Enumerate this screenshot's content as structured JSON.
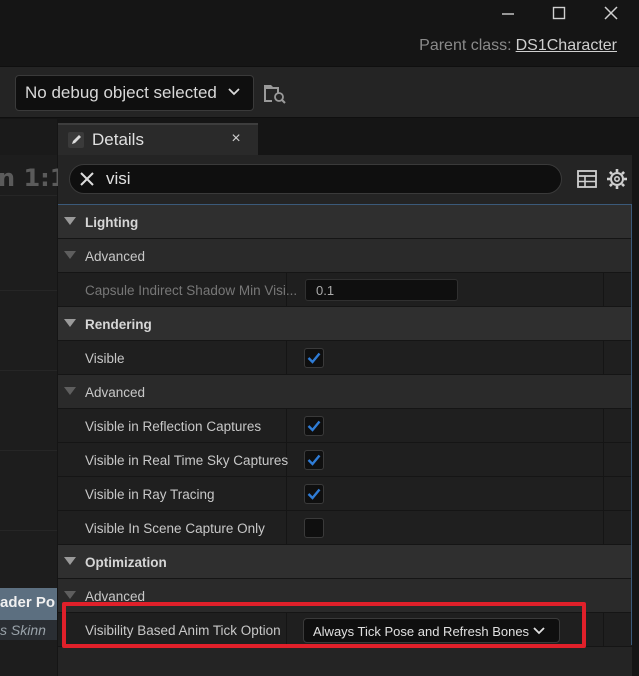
{
  "window": {
    "controls": {
      "minimize_icon": "minimize-icon",
      "maximize_icon": "maximize-icon",
      "close_icon": "close-icon"
    },
    "parent_class_label": "Parent class:",
    "parent_class_value": "DS1Character"
  },
  "toolbar": {
    "debug_object": "No debug object selected",
    "browse_icon": "folder-search-icon"
  },
  "viewport": {
    "zoom_label": "n 1:1",
    "node_title": "ader Po",
    "node_subtitle": "s Skinn"
  },
  "details": {
    "tab_label": "Details",
    "tab_close": "×",
    "search_value": "visi",
    "sections": {
      "lighting": "Lighting",
      "lighting_advanced": "Advanced",
      "capsule_shadow_label": "Capsule Indirect Shadow Min Visi...",
      "capsule_shadow_value": "0.1",
      "rendering": "Rendering",
      "visible": "Visible",
      "rendering_advanced": "Advanced",
      "visible_reflection": "Visible in Reflection Captures",
      "visible_sky": "Visible in Real Time Sky Captures",
      "visible_ray": "Visible in Ray Tracing",
      "visible_scene_capture": "Visible In Scene Capture Only",
      "optimization": "Optimization",
      "optimization_advanced": "Advanced",
      "anim_tick_label": "Visibility Based Anim Tick Option",
      "anim_tick_value": "Always Tick Pose and Refresh Bones"
    },
    "checkboxes": {
      "visible": true,
      "visible_reflection": true,
      "visible_sky": true,
      "visible_ray": true,
      "visible_scene_capture": false
    }
  },
  "colors": {
    "accent": "#2f7cd6",
    "highlight": "#e0202a"
  }
}
